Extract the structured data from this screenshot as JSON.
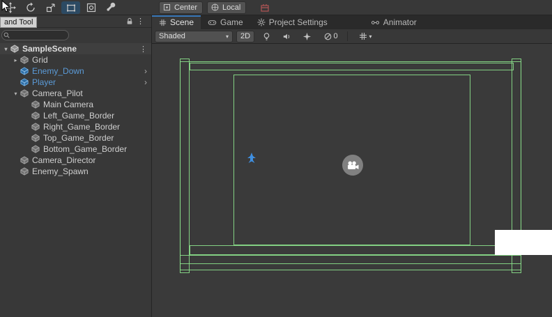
{
  "top_toolbar": {
    "tool_icons": [
      "move-tool-icon",
      "rotate-tool-icon",
      "scale-tool-icon",
      "rect-tool-icon",
      "transform-tool-icon",
      "custom-tool-icon"
    ],
    "selected_tool": "rect-tool",
    "pivot_button": "Center",
    "orientation_button": "Local"
  },
  "hierarchy_panel": {
    "tooltip_text": "and Tool",
    "search_value": "",
    "scene_row": {
      "label": "SampleScene"
    },
    "items": [
      {
        "label": "Grid"
      },
      {
        "label": "Enemy_Down"
      },
      {
        "label": "Player"
      },
      {
        "label": "Camera_Pilot"
      },
      {
        "label": "Main Camera"
      },
      {
        "label": "Left_Game_Border"
      },
      {
        "label": "Right_Game_Border"
      },
      {
        "label": "Top_Game_Border"
      },
      {
        "label": "Bottom_Game_Border"
      },
      {
        "label": "Camera_Director"
      },
      {
        "label": "Enemy_Spawn"
      }
    ]
  },
  "scene_panel": {
    "tabs": [
      {
        "label": "Scene",
        "active": true
      },
      {
        "label": "Game",
        "active": false
      },
      {
        "label": "Project Settings",
        "active": false
      },
      {
        "label": "Animator",
        "active": false
      }
    ],
    "toolbar": {
      "draw_mode": "Shaded",
      "mode_2d": "2D",
      "hidden_count": "0"
    }
  },
  "icons": {
    "collapsed": "▸",
    "expanded": "▾",
    "chevron": "›",
    "kebab": "⋮",
    "dropdown": "▾"
  },
  "colors": {
    "panel_bg": "#383838",
    "tabbar_bg": "#2a2a2a",
    "accent_blue": "#3a79bb",
    "prefab_blue": "#5b9bd8",
    "gizmo_green": "#8ce28c",
    "player_blue": "#3f8fe0"
  }
}
